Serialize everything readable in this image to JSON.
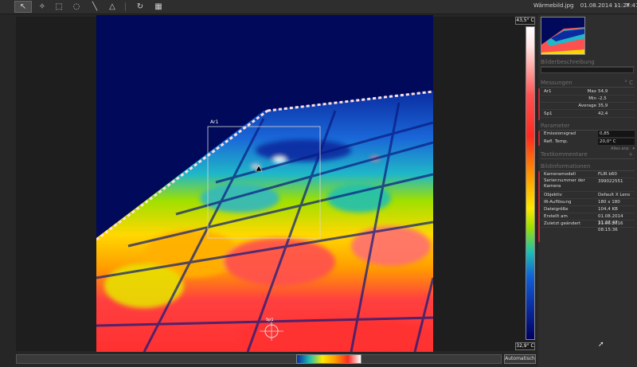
{
  "toolbar": {
    "tools": [
      {
        "name": "select-tool",
        "glyph": "↖",
        "active": true
      },
      {
        "name": "spot-tool",
        "glyph": "✧"
      },
      {
        "name": "box-tool",
        "glyph": "⬚"
      },
      {
        "name": "ellipse-tool",
        "glyph": "◌"
      },
      {
        "name": "line-tool",
        "glyph": "╲"
      },
      {
        "name": "delta-tool",
        "glyph": "△"
      },
      {
        "name": "rotate-tool",
        "glyph": "↻"
      },
      {
        "name": "palette-tool",
        "glyph": "▦"
      }
    ],
    "filename": "Wärmebild.jpg",
    "datetime": "01.08.2014 11:27:47"
  },
  "scale": {
    "max": "43,5° C",
    "min": "32,9° C"
  },
  "overlay": {
    "box_label": "Ar1",
    "spot_label": "Sp1"
  },
  "bottom": {
    "auto_button": "Automatisch"
  },
  "panel": {
    "image_description_heading": "Bilderbeschreibung",
    "measurements_heading": "Messungen",
    "measurements_unit": "° C",
    "measurements": [
      {
        "name": "Ar1",
        "stat": "Max",
        "value": "54,9"
      },
      {
        "name": "",
        "stat": "Min",
        "value": "-2,5"
      },
      {
        "name": "",
        "stat": "Average",
        "value": "35,9"
      },
      {
        "name": "Sp1",
        "stat": "",
        "value": "42,4"
      }
    ],
    "parameters_heading": "Parameter",
    "parameters": [
      {
        "name": "Emissionsgrad",
        "value": "0,85"
      },
      {
        "name": "Refl. Temp.",
        "value": "20,0° C"
      }
    ],
    "show_all": "Alles anz.",
    "text_comments_heading": "Textkommentare",
    "image_info_heading": "Bildinformationen",
    "image_info": [
      {
        "name": "Kameramodell",
        "value": "FLIR b60"
      },
      {
        "name": "Seriennummer der Kamera",
        "value": "399022551"
      },
      {
        "name": "Objektiv",
        "value": "Default X Lens"
      },
      {
        "name": "IR-Auflösung",
        "value": "180 x 180"
      },
      {
        "name": "Dateigröße",
        "value": "104,4 KB"
      },
      {
        "name": "Erstellt am",
        "value": "01.08.2014 11:27:47"
      },
      {
        "name": "Zuletzt geändert",
        "value": "21.06.2016 08:15:36"
      }
    ]
  }
}
